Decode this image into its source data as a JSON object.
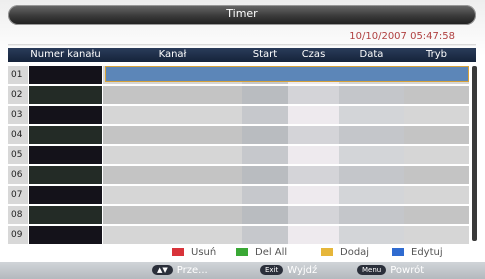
{
  "title": "Timer",
  "datetime": "10/10/2007 05:47:58",
  "columns": {
    "numer": "Numer kanału",
    "kanal": "Kanał",
    "start": "Start",
    "czas": "Czas",
    "data": "Data",
    "tryb": "Tryb"
  },
  "rows": [
    "01",
    "02",
    "03",
    "04",
    "05",
    "06",
    "07",
    "08",
    "09"
  ],
  "selected_row": "01",
  "legend": {
    "usun": {
      "label": "Usuń",
      "color": "#d8333a"
    },
    "del_all": {
      "label": "Del All",
      "color": "#3aa835"
    },
    "dodaj": {
      "label": "Dodaj",
      "color": "#e6b63a"
    },
    "edytuj": {
      "label": "Edytuj",
      "color": "#2f6bd0"
    }
  },
  "footer": {
    "nav_key": "▲▼",
    "nav_label": "Prze...",
    "exit_key": "Exit",
    "exit_label": "Wyjdź",
    "menu_key": "Menu",
    "menu_label": "Powrót"
  }
}
